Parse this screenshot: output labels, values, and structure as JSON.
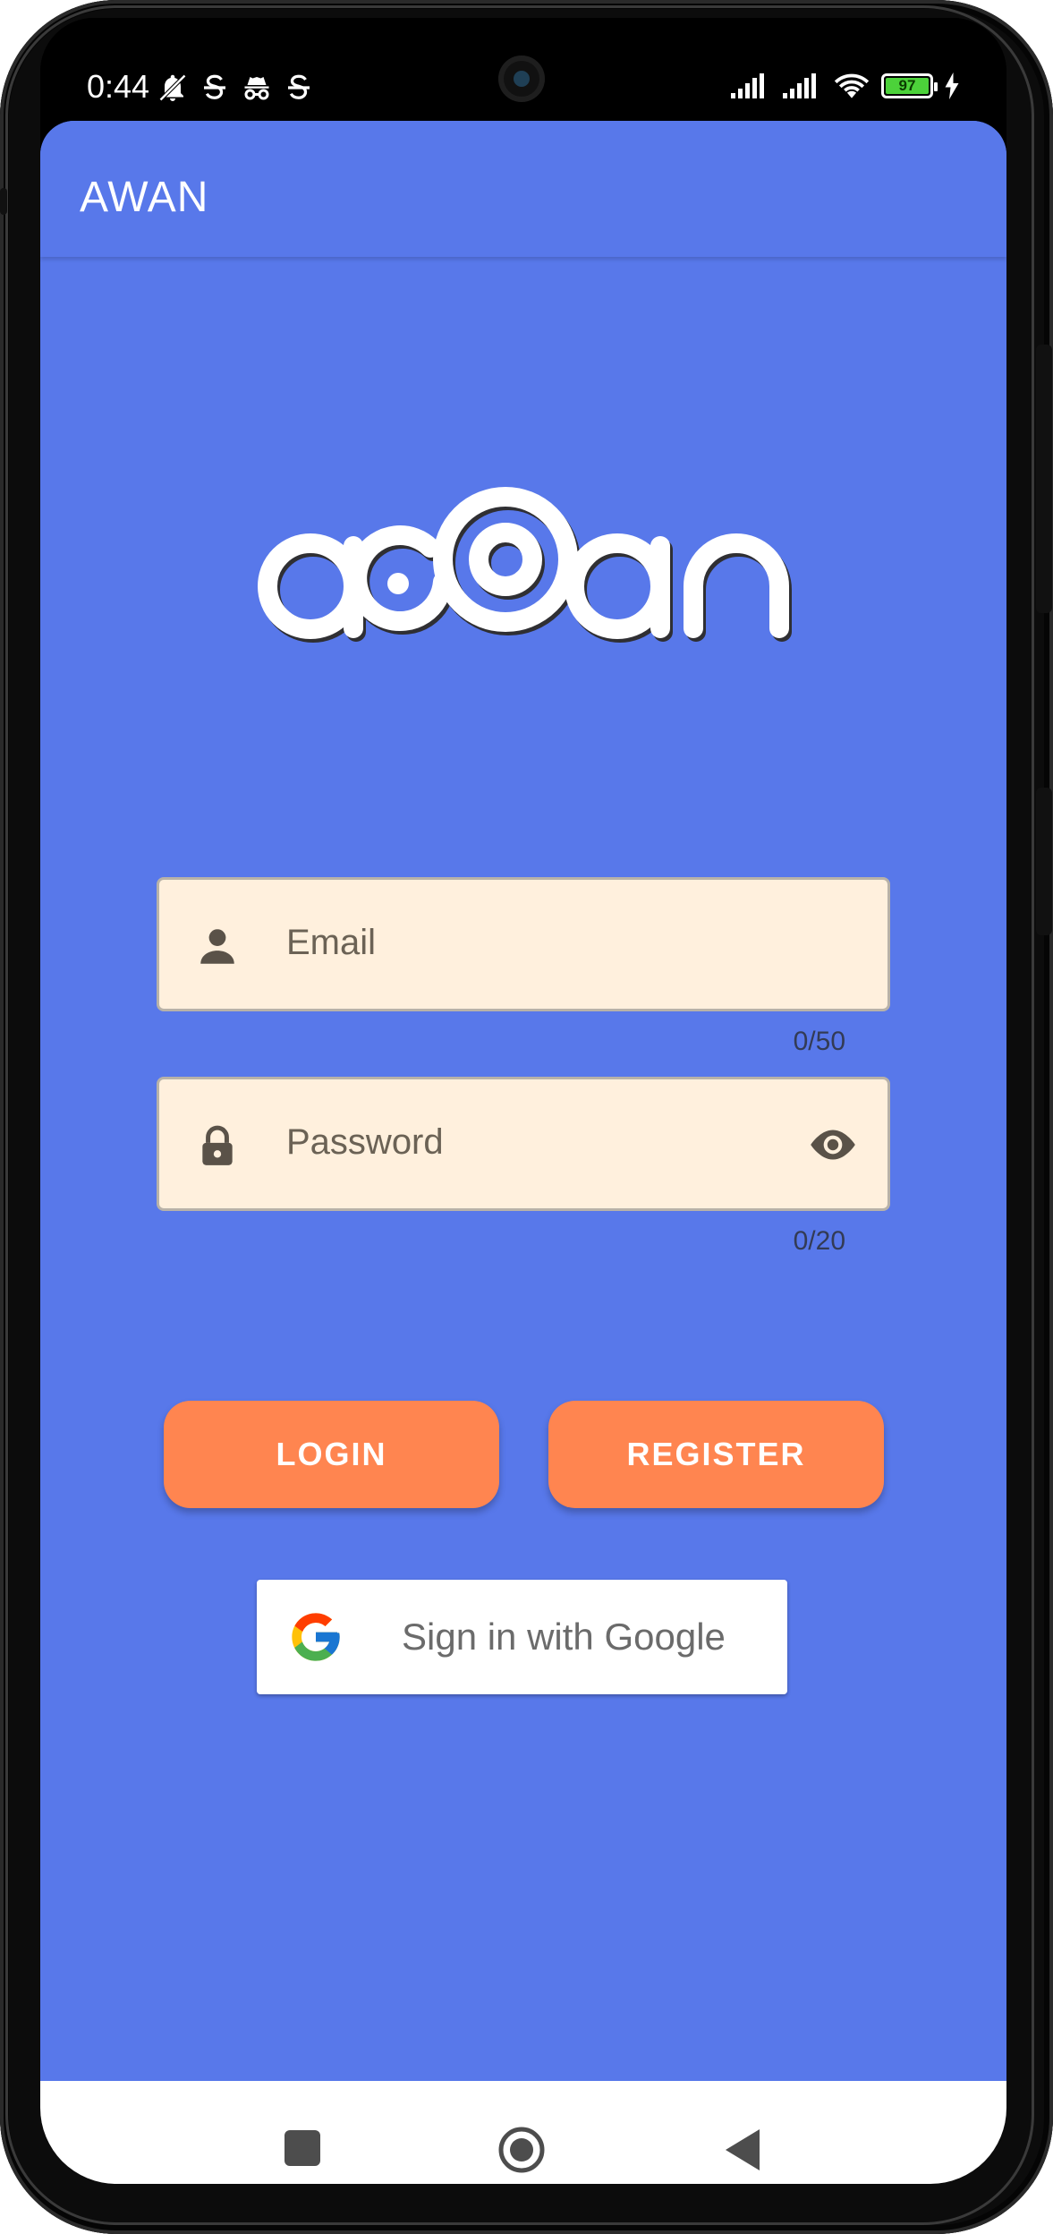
{
  "status_bar": {
    "time": "0:44",
    "battery_level": "97",
    "left_icons": [
      "notifications-off-icon",
      "strikethrough-s-icon",
      "incognito-icon",
      "strikethrough-s-icon"
    ],
    "right_icons": [
      "signal-icon",
      "signal-icon",
      "wifi-icon",
      "battery-icon",
      "charging-icon"
    ]
  },
  "app_bar": {
    "title": "AWAN"
  },
  "logo": {
    "text": "awan"
  },
  "email_field": {
    "placeholder": "Email",
    "value": "",
    "counter": "0/50",
    "icon": "person-icon"
  },
  "password_field": {
    "placeholder": "Password",
    "value": "",
    "counter": "0/20",
    "icon": "lock-icon",
    "toggle_icon": "eye-icon"
  },
  "buttons": {
    "login": "LOGIN",
    "register": "REGISTER"
  },
  "google_button": {
    "label": "Sign in with Google",
    "icon": "google-icon"
  },
  "nav_bar": {
    "items": [
      "recents-icon",
      "home-icon",
      "back-icon"
    ]
  },
  "colors": {
    "primary": "#5878ea",
    "accent": "#ff8550",
    "field_background": "#fff0dd",
    "on_primary": "#ffffff"
  }
}
